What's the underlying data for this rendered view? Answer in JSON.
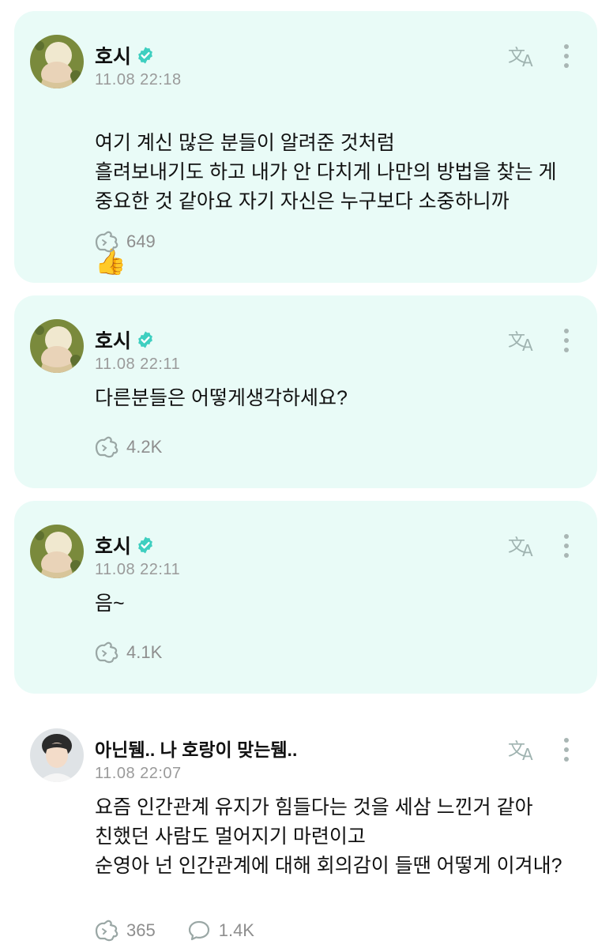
{
  "colors": {
    "card_bg": "#e9fbf7",
    "accent": "#3ecfc0",
    "meta": "#9a9a9a"
  },
  "posts": [
    {
      "author": "호시",
      "verified": true,
      "timestamp": "11.08 22:18",
      "text": "여기 계신 많은 분들이 알려준 것처럼\n흘려보내기도 하고 내가 안 다치게 나만의 방법을 찾는 게 중요한 것 같아요 자기 자신은 누구보다 소중하니까",
      "emoji": "👍",
      "likes": "649"
    },
    {
      "author": "호시",
      "verified": true,
      "timestamp": "11.08 22:11",
      "text": "다른분들은 어떻게생각하세요?",
      "likes": "4.2K"
    },
    {
      "author": "호시",
      "verified": true,
      "timestamp": "11.08 22:11",
      "text": "음~",
      "likes": "4.1K"
    },
    {
      "author": "아닌뒘.. 나 호랑이 맞는뒘..",
      "verified": false,
      "timestamp": "11.08 22:07",
      "text": "요즘 인간관계 유지가 힘들다는 것을 세삼 느낀거 같아\n친했던 사람도 멀어지기 마련이고\n순영아 넌 인간관계에 대해 회의감이 들땐 어떻게 이겨내?",
      "likes": "365",
      "comments": "1.4K"
    }
  ],
  "icons": {
    "verified": "verified-badge-icon",
    "translate": "translate-icon",
    "more": "more-vertical-icon",
    "like": "like-hand-icon",
    "comment": "comment-bubble-icon"
  }
}
